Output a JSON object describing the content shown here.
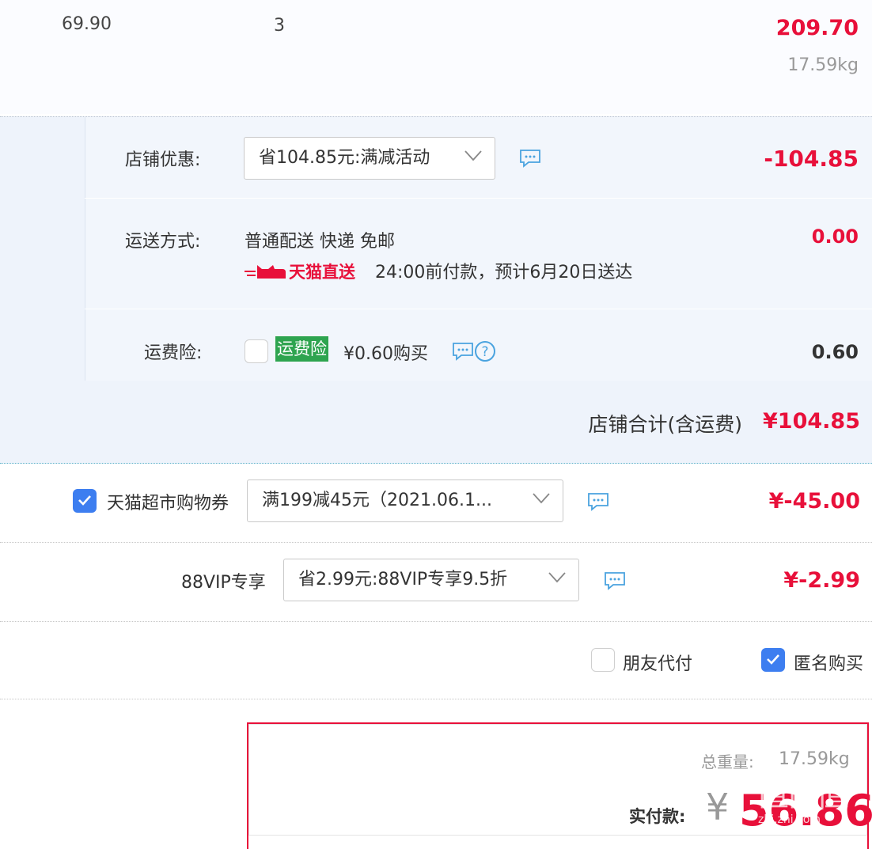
{
  "item": {
    "unit_price": "69.90",
    "quantity": "3",
    "subtotal": "209.70",
    "weight": "17.59kg"
  },
  "store": {
    "discount_label": "店铺优惠:",
    "discount_select": "省104.85元:满减活动",
    "discount_amount": "-104.85",
    "shipping_label": "运送方式:",
    "shipping_method": "普通配送 快递 免邮",
    "shipping_badge": "天猫直送",
    "shipping_note": "24:00前付款，预计6月20日送达",
    "shipping_amount": "0.00",
    "insurance_label": "运费险:",
    "insurance_tag": "运费险",
    "insurance_price": "¥0.60购买",
    "insurance_amount": "0.60",
    "total_label": "店铺合计(含运费)",
    "total_amount": "¥104.85"
  },
  "coupon": {
    "label": "天猫超市购物券",
    "select": "满199减45元（2021.06.1...",
    "amount": "¥-45.00",
    "checked": true
  },
  "vip": {
    "label": "88VIP专享",
    "select": "省2.99元:88VIP专享9.5折",
    "amount": "¥-2.99"
  },
  "options": {
    "friend_pay": "朋友代付",
    "anonymous": "匿名购买"
  },
  "payment": {
    "weight_label": "总重量:",
    "weight_value": "17.59kg",
    "pay_label": "实付款:",
    "currency": "¥",
    "amount": "56.86"
  },
  "watermark": "值 什么值得买",
  "colors": {
    "accent_red": "#e8103a",
    "checkbox_blue": "#3d7ef0",
    "insurance_green": "#2ea44f",
    "icon_blue": "#4aa3df"
  }
}
